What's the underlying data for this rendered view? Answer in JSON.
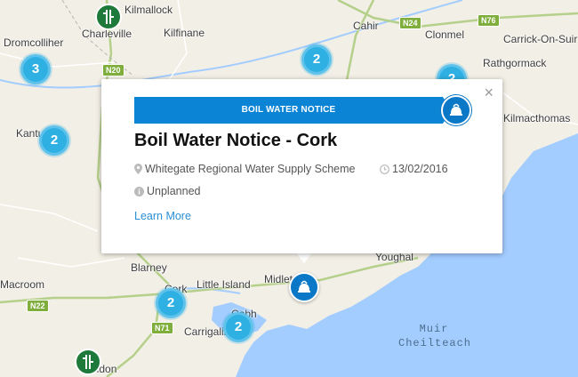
{
  "places": [
    {
      "name": "Kilmallock"
    },
    {
      "name": "Charleville"
    },
    {
      "name": "Kilfinane"
    },
    {
      "name": "Cahir"
    },
    {
      "name": "Clonmel"
    },
    {
      "name": "Carrick-On-Suir"
    },
    {
      "name": "Dromcolliher"
    },
    {
      "name": "Rathgormack"
    },
    {
      "name": "Kilmacthomas"
    },
    {
      "name": "Kantu"
    },
    {
      "name": "Blarney"
    },
    {
      "name": "Youghal"
    },
    {
      "name": "Macroom"
    },
    {
      "name": "Cork"
    },
    {
      "name": "Little Island"
    },
    {
      "name": "Midlet"
    },
    {
      "name": "Cobh"
    },
    {
      "name": "Carrigalin"
    },
    {
      "name": "Bandon"
    }
  ],
  "road_shields": [
    {
      "label": "N20"
    },
    {
      "label": "N24"
    },
    {
      "label": "N76"
    },
    {
      "label": "N22"
    },
    {
      "label": "N71"
    }
  ],
  "sea_label": [
    "Muir",
    "Cheilteach"
  ],
  "clusters": [
    {
      "count": "3"
    },
    {
      "count": "2"
    },
    {
      "count": "2"
    },
    {
      "count": "2"
    },
    {
      "count": "2"
    },
    {
      "count": "2"
    }
  ],
  "popup": {
    "banner": "BOIL WATER NOTICE",
    "title": "Boil Water Notice - Cork",
    "location": "Whitegate Regional Water Supply Scheme",
    "date": "13/02/2016",
    "type": "Unplanned",
    "link": "Learn More",
    "close": "×",
    "icon": "kettle-icon"
  },
  "colors": {
    "banner": "#0b84d6",
    "cluster": "#2fb0e3",
    "sea": "#a3ccff",
    "land": "#f2efe6",
    "link": "#2b8fd6"
  }
}
